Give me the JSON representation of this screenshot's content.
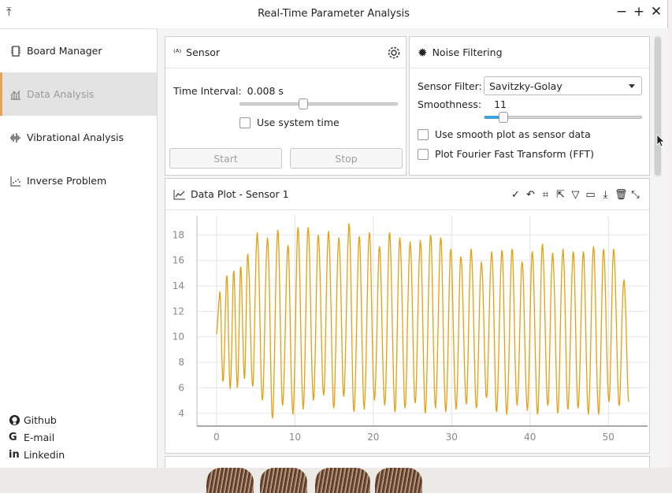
{
  "window": {
    "title": "Real-Time Parameter Analysis"
  },
  "sidebar": {
    "items": [
      {
        "label": "Board Manager",
        "icon": "board-icon"
      },
      {
        "label": "Data Analysis",
        "icon": "bar-chart-icon",
        "active": true
      },
      {
        "label": "Vibrational Analysis",
        "icon": "waveform-icon"
      },
      {
        "label": "Inverse Problem",
        "icon": "scatter-icon"
      }
    ],
    "links": [
      {
        "label": "Github",
        "icon": "github-icon"
      },
      {
        "label": "E-mail",
        "icon": "google-icon"
      },
      {
        "label": "Linkedin",
        "icon": "linkedin-icon"
      }
    ]
  },
  "sensor": {
    "title": "Sensor",
    "time_interval_label": "Time Interval:",
    "time_interval_value": "0.008 s",
    "slider_level": 0.4,
    "use_system_time": "Use system time",
    "start": "Start",
    "stop": "Stop"
  },
  "noise": {
    "title": "Noise Filtering",
    "filter_label": "Sensor Filter:",
    "filter_value": "Savitzky-Golay",
    "smoothness_label": "Smoothness:",
    "smoothness_value": "11",
    "smoothness_level": 0.12,
    "smooth_plot": "Use smooth plot as sensor data",
    "fft": "Plot Fourier Fast Transform (FFT)"
  },
  "plot": {
    "title": "Data Plot - Sensor 1"
  },
  "colors": {
    "accent": "#e9a15a",
    "series": "#e3a012",
    "slider": "#3ea2de"
  },
  "chart_data": {
    "type": "line",
    "title": "",
    "xlabel": "",
    "ylabel": "",
    "xlim": [
      -2.5,
      55
    ],
    "ylim": [
      3,
      19.5
    ],
    "xticks": [
      0,
      10,
      20,
      30,
      40,
      50
    ],
    "yticks": [
      4,
      6,
      8,
      10,
      12,
      14,
      16,
      18
    ],
    "grid": true,
    "series": [
      {
        "peaks_x": [
          0.4,
          1.3,
          2.2,
          3.1,
          4.0,
          5.2,
          6.5,
          7.8,
          9.1,
          10.4,
          11.7,
          13.0,
          14.3,
          15.6,
          16.9,
          18.2,
          19.5,
          20.8,
          22.1,
          23.4,
          24.7,
          26.0,
          27.3,
          28.6,
          29.9,
          31.2,
          32.5,
          33.8,
          35.1,
          36.4,
          37.7,
          39.0,
          40.3,
          41.6,
          42.9,
          44.2,
          45.5,
          46.8,
          48.1,
          49.4,
          50.7,
          52.0
        ],
        "peaks_y": [
          13.5,
          14.8,
          15.2,
          15.5,
          16.5,
          18.2,
          17.8,
          18.4,
          17.2,
          18.6,
          18.6,
          18.0,
          18.3,
          17.8,
          18.9,
          17.9,
          18.2,
          17.1,
          18.2,
          17.8,
          17.5,
          17.6,
          18.0,
          17.8,
          16.9,
          16.3,
          16.9,
          15.9,
          16.7,
          16.8,
          16.9,
          15.9,
          16.7,
          17.3,
          16.6,
          16.9,
          16.7,
          16.7,
          17.1,
          16.9,
          16.9,
          14.5
        ],
        "troughs_x": [
          0.85,
          1.75,
          2.65,
          3.55,
          4.6,
          5.85,
          7.15,
          8.45,
          9.75,
          11.05,
          12.35,
          13.65,
          14.95,
          16.25,
          17.55,
          18.85,
          20.15,
          21.45,
          22.75,
          24.05,
          25.35,
          26.65,
          27.95,
          29.25,
          30.55,
          31.85,
          33.15,
          34.45,
          35.75,
          37.05,
          38.35,
          39.65,
          40.95,
          42.25,
          43.55,
          44.85,
          46.15,
          47.45,
          48.75,
          50.05,
          51.35,
          52.6
        ],
        "troughs_y": [
          6.5,
          5.9,
          6.0,
          6.7,
          6.1,
          5.0,
          3.6,
          4.6,
          3.9,
          4.3,
          5.0,
          5.4,
          4.4,
          5.3,
          4.1,
          4.3,
          5.0,
          4.6,
          4.1,
          4.4,
          4.8,
          4.0,
          4.4,
          4.1,
          4.3,
          4.7,
          4.4,
          5.2,
          4.1,
          3.9,
          4.6,
          4.2,
          3.9,
          4.6,
          4.0,
          4.3,
          4.4,
          3.9,
          3.9,
          4.9,
          4.6,
          4.9
        ]
      }
    ]
  }
}
